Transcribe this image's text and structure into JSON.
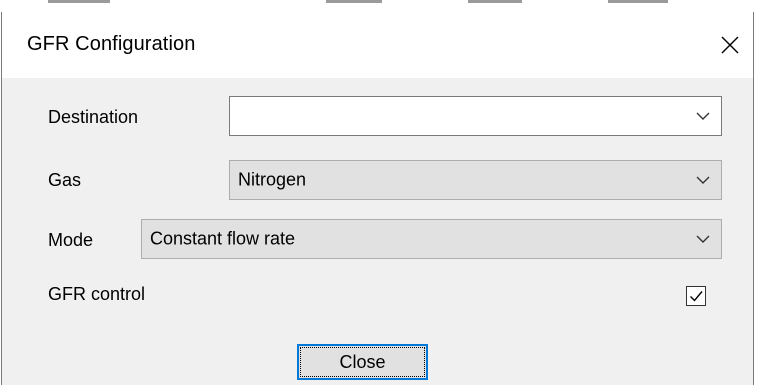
{
  "dialog": {
    "title": "GFR Configuration",
    "close_icon": "close-icon"
  },
  "fields": {
    "destination": {
      "label": "Destination",
      "value": ""
    },
    "gas": {
      "label": "Gas",
      "value": "Nitrogen"
    },
    "mode": {
      "label": "Mode",
      "value": "Constant flow rate"
    },
    "gfr_control": {
      "label": "GFR control",
      "checked": true
    }
  },
  "buttons": {
    "close_label": "Close"
  },
  "colors": {
    "accent": "#0078d7",
    "dialog_bg": "#f0f0f0",
    "combo_bg": "#e1e1e1"
  }
}
